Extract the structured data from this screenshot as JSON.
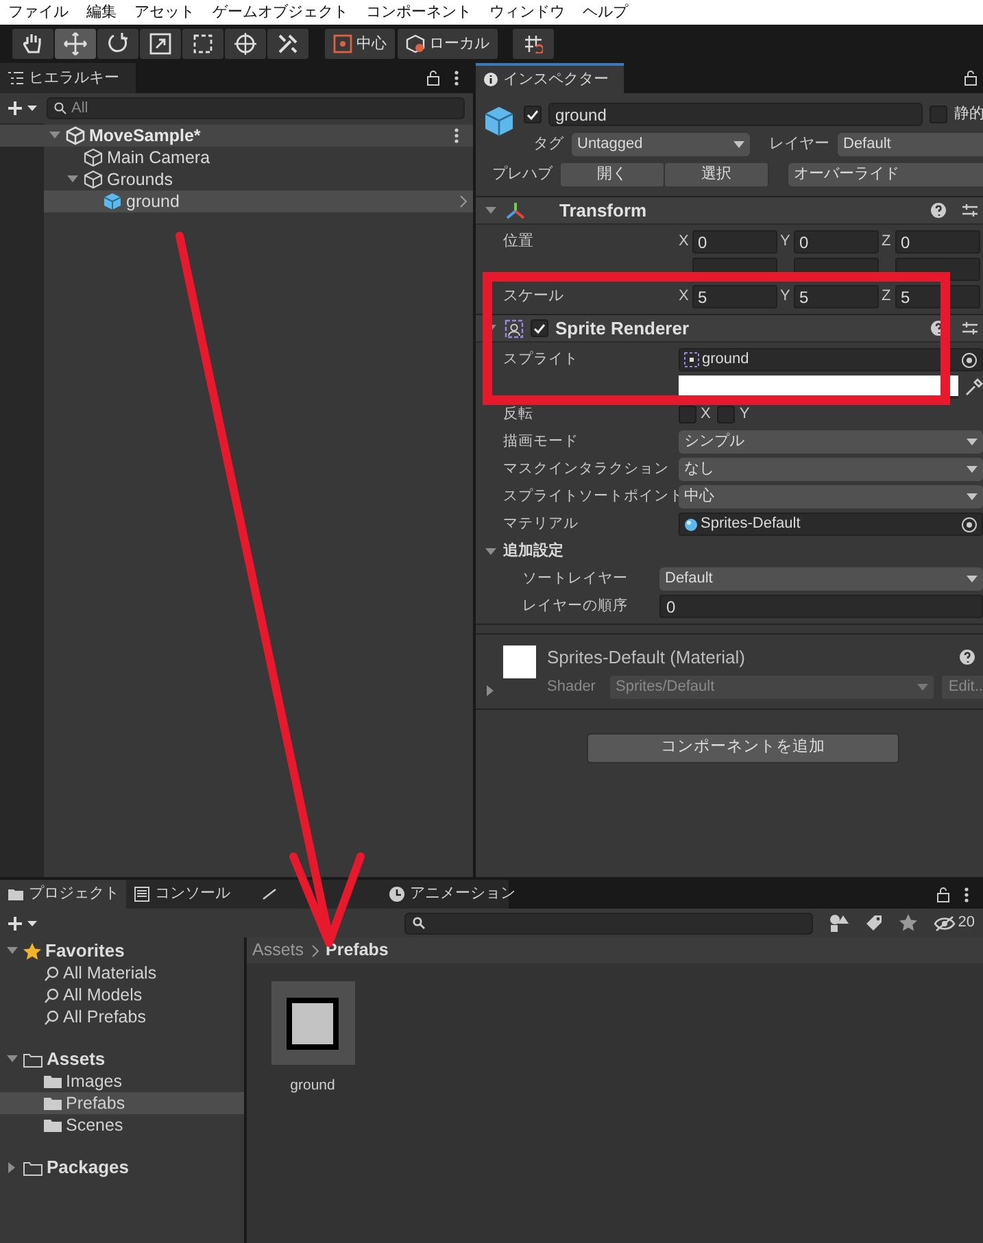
{
  "menu_bar": [
    "ファイル",
    "編集",
    "アセット",
    "ゲームオブジェクト",
    "コンポーネント",
    "ウィンドウ",
    "ヘルプ"
  ],
  "toolbar": {
    "tools": [
      {
        "kind": "hand",
        "selected": false
      },
      {
        "kind": "move",
        "selected": true
      },
      {
        "kind": "rotate",
        "selected": false
      },
      {
        "kind": "scale",
        "selected": false
      },
      {
        "kind": "rect",
        "selected": false
      },
      {
        "kind": "transform",
        "selected": false
      },
      {
        "kind": "custom",
        "selected": false
      }
    ],
    "pivot": "中心",
    "space": "ローカル"
  },
  "hierarchy": {
    "tab": "ヒエラルキー",
    "search_placeholder": "All",
    "items": [
      {
        "label": "MoveSample*",
        "kind": "scene",
        "expanded": true,
        "children": [
          {
            "label": "Main Camera",
            "kind": "object",
            "selected": false
          },
          {
            "label": "Grounds",
            "kind": "object",
            "expanded": true,
            "selected": false,
            "children": [
              {
                "label": "ground",
                "kind": "prefab",
                "selected": true
              }
            ]
          }
        ]
      }
    ]
  },
  "inspector": {
    "tab": "インスペクター",
    "active": true,
    "name": "ground",
    "static_label": "静的",
    "static": false,
    "tag_label": "タグ",
    "tag": "Untagged",
    "layer_label": "レイヤー",
    "layer": "Default",
    "prefab_label": "プレハブ",
    "prefab_buttons": [
      "開く",
      "選択"
    ],
    "overrides": "オーバーライド",
    "transform": {
      "title": "Transform",
      "expanded": true,
      "rows": [
        {
          "kind": "vector",
          "label": "位置",
          "values": [
            {
              "axis": "X",
              "value": "0"
            },
            {
              "axis": "Y",
              "value": "0"
            },
            {
              "axis": "Z",
              "value": "0"
            }
          ]
        },
        {
          "kind": "covered"
        },
        {
          "kind": "vector",
          "label": "スケール",
          "values": [
            {
              "axis": "X",
              "value": "5"
            },
            {
              "axis": "Y",
              "value": "5"
            },
            {
              "axis": "Z",
              "value": "5"
            }
          ]
        }
      ]
    },
    "sprite_renderer": {
      "title": "Sprite Renderer",
      "enabled": true,
      "expanded": true,
      "fields": [
        {
          "kind": "sprite",
          "label": "スプライト",
          "value": "ground"
        },
        {
          "kind": "color"
        },
        {
          "kind": "flip",
          "label": "反転",
          "options": [
            {
              "label": "X",
              "checked": false
            },
            {
              "label": "Y",
              "checked": false
            }
          ]
        },
        {
          "kind": "dropdown",
          "label": "描画モード",
          "value": "シンプル"
        },
        {
          "kind": "dropdown",
          "label": "マスクインタラクション",
          "value": "なし"
        },
        {
          "kind": "dropdown",
          "label": "スプライトソートポイント",
          "value": "中心"
        },
        {
          "kind": "material",
          "label": "マテリアル",
          "value": "Sprites-Default"
        },
        {
          "kind": "section",
          "label": "追加設定",
          "expanded": true,
          "children": [
            {
              "kind": "dropdown",
              "label": "ソートレイヤー",
              "value": "Default"
            },
            {
              "kind": "number",
              "label": "レイヤーの順序",
              "value": "0"
            }
          ]
        }
      ]
    },
    "material": {
      "title": "Sprites-Default (Material)",
      "expanded": false,
      "shader_label": "Shader",
      "shader": "Sprites/Default",
      "edit": "Edit..."
    },
    "add_component": "コンポーネントを追加"
  },
  "project": {
    "tabs": [
      {
        "kind": "project",
        "label": "プロジェクト",
        "selected": true
      },
      {
        "kind": "console",
        "label": "コンソール",
        "selected": false
      },
      {
        "kind": "animator",
        "selected": false
      },
      {
        "kind": "animation",
        "label": "アニメーション",
        "selected": false
      }
    ],
    "hidden_count": "20",
    "tree": [
      {
        "kind": "favorites",
        "label": "Favorites",
        "expanded": true,
        "selected": false,
        "children": [
          {
            "kind": "search",
            "label": "All Materials",
            "selected": false
          },
          {
            "kind": "search",
            "label": "All Models",
            "selected": false
          },
          {
            "kind": "search",
            "label": "All Prefabs",
            "selected": false
          }
        ]
      },
      {
        "kind": "folder",
        "label": "Assets",
        "expanded": true,
        "selected": false,
        "children": [
          {
            "kind": "folder",
            "label": "Images",
            "selected": false
          },
          {
            "kind": "folder",
            "label": "Prefabs",
            "selected": true
          },
          {
            "kind": "folder",
            "label": "Scenes",
            "selected": false
          }
        ]
      },
      {
        "kind": "folder",
        "label": "Packages",
        "expanded": false,
        "selected": false
      }
    ],
    "breadcrumb": [
      "Assets",
      "Prefabs"
    ],
    "assets": [
      {
        "label": "ground"
      }
    ]
  },
  "annotations": {
    "highlight_box": true,
    "arrow": true
  }
}
